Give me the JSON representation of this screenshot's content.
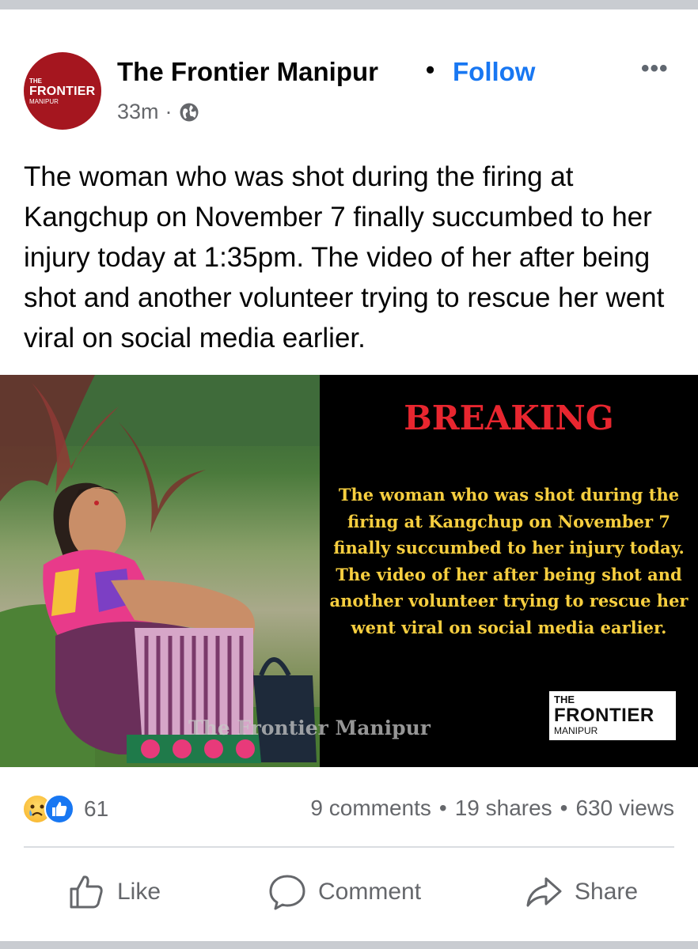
{
  "post": {
    "page_name": "The Frontier Manipur",
    "separator": "•",
    "follow_label": "Follow",
    "more_label": "•••",
    "time": "33m",
    "meta_sep": "·",
    "privacy_icon": "globe-icon",
    "text": "The woman who was shot during the firing at Kangchup on November 7 finally succumbed to her injury today at 1:35pm. The video of her after being shot and another volunteer trying to rescue her went viral on social media earlier."
  },
  "avatar": {
    "line1": "THE",
    "line2": "FRONTIER",
    "line3": "MANIPUR"
  },
  "image": {
    "headline": "BREAKING",
    "headline_color": "#e8262f",
    "body": "The woman who was shot during the firing at Kangchup on November 7 finally succumbed to her injury today. The video of her after being shot and another volunteer trying to rescue her went viral on social media earlier.",
    "body_color": "#f6ce3f",
    "logo_line1": "THE",
    "logo_line2": "FRONTIER",
    "logo_line3": "MANIPUR",
    "watermark": "The Frontier Manipur"
  },
  "engagement": {
    "reaction_icons": [
      "sad-reaction-icon",
      "like-reaction-icon"
    ],
    "reaction_count": "61",
    "comments": "9 comments",
    "shares": "19 shares",
    "views": "630 views",
    "sep": "•"
  },
  "actions": {
    "like": "Like",
    "comment": "Comment",
    "share": "Share"
  },
  "colors": {
    "accent": "#1877f2",
    "muted": "#65676b",
    "brand_red": "#a5161f"
  }
}
